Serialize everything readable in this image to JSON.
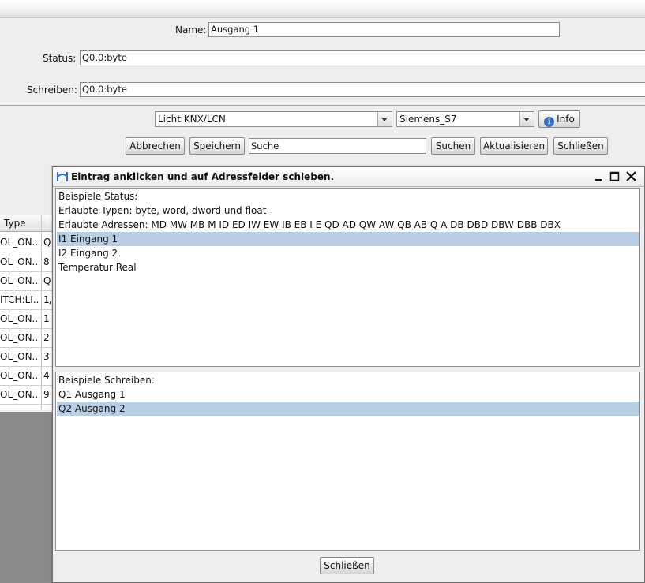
{
  "form": {
    "name_label": "Name:",
    "name_value": "Ausgang 1",
    "status_label": "Status:",
    "status_value": "Q0.0:byte",
    "write_label": "Schreiben:",
    "write_value": "Q0.0:byte"
  },
  "selectors": {
    "device": "Licht KNX/LCN",
    "plc": "Siemens_S7",
    "info_label": "Info"
  },
  "toolbar": {
    "cancel_label": "Abbrechen",
    "save_label": "Speichern",
    "search_value": "Suche",
    "search_button": "Suchen",
    "refresh_label": "Aktualisieren",
    "close_label": "Schließen"
  },
  "background_table": {
    "header_type": "Type",
    "rows": [
      {
        "type": "OL_ON...",
        "val": "Q"
      },
      {
        "type": "OL_ON...",
        "val": "8"
      },
      {
        "type": "OL_ON...",
        "val": "Q"
      },
      {
        "type": "ITCH:LI...",
        "val": "1/"
      },
      {
        "type": "OL_ON...",
        "val": "1"
      },
      {
        "type": "OL_ON...",
        "val": "2"
      },
      {
        "type": "OL_ON...",
        "val": "3"
      },
      {
        "type": "OL_ON...",
        "val": "4"
      },
      {
        "type": "OL_ON...",
        "val": "9"
      }
    ]
  },
  "dialog": {
    "title": "Eintrag anklicken und auf Adressfelder schieben.",
    "status_panel": {
      "line1": "Beispiele Status:",
      "line2": "Erlaubte Typen: byte, word,  dword und  float",
      "line3": "Erlaubte Adressen:  MD  MW MB M  ID ED IW EW IB EB I E  QD AD QW AW  QB AB Q A DB DBD DBW DBB DBX",
      "items": [
        "I1 Eingang 1",
        "I2 Eingang 2",
        "Temperatur Real"
      ],
      "selected_index": 0
    },
    "write_panel": {
      "line1": "Beispiele Schreiben:",
      "items": [
        "Q1 Ausgang 1",
        "Q2 Ausgang 2"
      ],
      "selected_index": 1
    },
    "close_button": "Schließen"
  },
  "colors": {
    "selection": "#b8cfe5",
    "info_icon": "#2f6fc6",
    "overlay_grey": "#8a8a8a"
  },
  "icons": [
    "app-icon",
    "info-icon",
    "minimize-icon",
    "maximize-icon",
    "close-icon",
    "chevron-down-icon"
  ]
}
